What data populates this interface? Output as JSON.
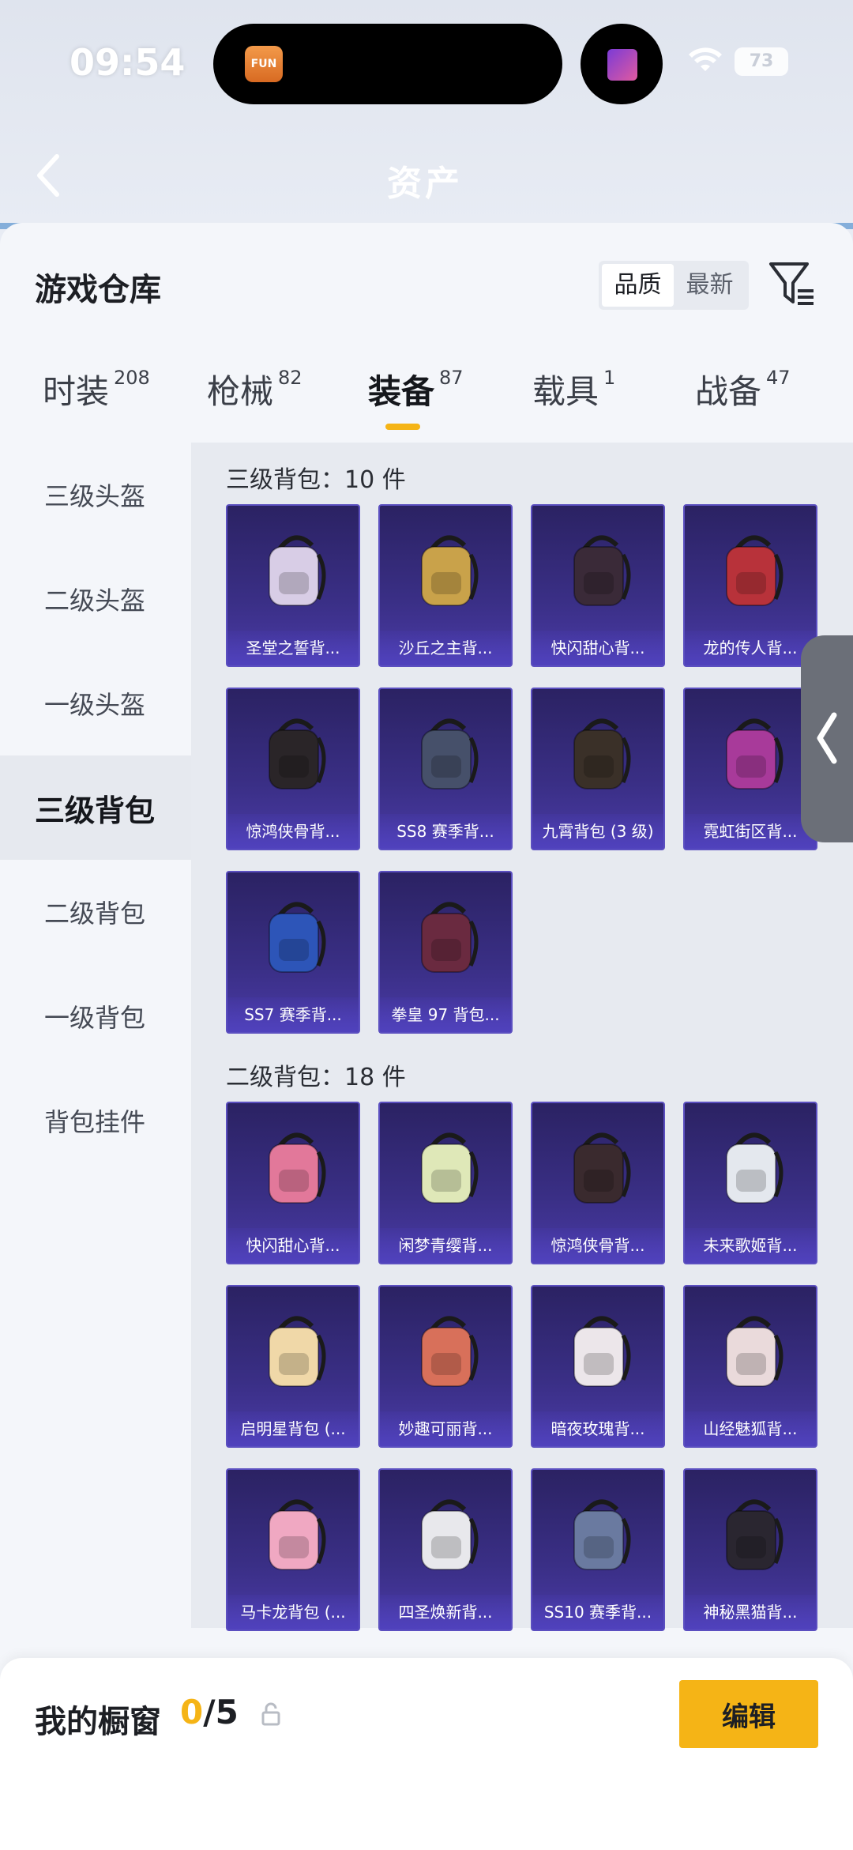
{
  "status_bar": {
    "time": "09:54",
    "battery": "73",
    "island_app_label": "FUN"
  },
  "header": {
    "title": "资产"
  },
  "sheet": {
    "title": "游戏仓库",
    "sort_options": [
      "品质",
      "最新"
    ],
    "sort_active": "品质"
  },
  "tabs": [
    {
      "label": "时装",
      "count": "208"
    },
    {
      "label": "枪械",
      "count": "82"
    },
    {
      "label": "装备",
      "count": "87"
    },
    {
      "label": "载具",
      "count": "1"
    },
    {
      "label": "战备",
      "count": "47"
    }
  ],
  "active_tab": "装备",
  "sidenav": [
    "三级头盔",
    "二级头盔",
    "一级头盔",
    "三级背包",
    "二级背包",
    "一级背包",
    "背包挂件"
  ],
  "sidenav_active": "三级背包",
  "sections": [
    {
      "title": "三级背包：10 件",
      "items": [
        {
          "name": "圣堂之誓背...",
          "art": "winged-backpack-icon",
          "color": "#d8cde6"
        },
        {
          "name": "沙丘之主背...",
          "art": "scroll-backpack-icon",
          "color": "#c9a24a"
        },
        {
          "name": "快闪甜心背...",
          "art": "heart-backpack-icon",
          "color": "#3a2a38"
        },
        {
          "name": "龙的传人背...",
          "art": "dragon-backpack-icon",
          "color": "#b8323a"
        },
        {
          "name": "惊鸿侠骨背...",
          "art": "dark-backpack-icon",
          "color": "#2a2528"
        },
        {
          "name": "SS8 赛季背...",
          "art": "striped-backpack-icon",
          "color": "#46506a"
        },
        {
          "name": "九霄背包 (3 级)",
          "art": "gold-backpack-icon",
          "color": "#3a3028"
        },
        {
          "name": "霓虹街区背...",
          "art": "neon-backpack-icon",
          "color": "#a83a9a"
        },
        {
          "name": "SS7 赛季背...",
          "art": "blue-backpack-icon",
          "color": "#2d55b8"
        },
        {
          "name": "拳皇 97 背包...",
          "art": "kof-backpack-icon",
          "color": "#6a2a40"
        }
      ]
    },
    {
      "title": "二级背包：18 件",
      "items": [
        {
          "name": "快闪甜心背...",
          "art": "pink-round-backpack-icon",
          "color": "#e2789a"
        },
        {
          "name": "闲梦青缨背...",
          "art": "green-pouch-backpack-icon",
          "color": "#dfe8b8"
        },
        {
          "name": "惊鸿侠骨背...",
          "art": "dark-red-backpack-icon",
          "color": "#3a2a2e"
        },
        {
          "name": "未来歌姬背...",
          "art": "white-backpack-icon",
          "color": "#e4e8ee"
        },
        {
          "name": "启明星背包 (...",
          "art": "cream-backpack-icon",
          "color": "#f0d8a8"
        },
        {
          "name": "妙趣可丽背...",
          "art": "gift-backpack-icon",
          "color": "#d8705a"
        },
        {
          "name": "暗夜玫瑰背...",
          "art": "bunny-backpack-icon",
          "color": "#ece6ea"
        },
        {
          "name": "山经魅狐背...",
          "art": "fox-backpack-icon",
          "color": "#eadadb"
        },
        {
          "name": "马卡龙背包 (...",
          "art": "macaron-backpack-icon",
          "color": "#f0a8c2"
        },
        {
          "name": "四圣焕新背...",
          "art": "capsule-backpack-icon",
          "color": "#e8e8ec"
        },
        {
          "name": "SS10 赛季背...",
          "art": "denim-backpack-icon",
          "color": "#6a7aa0"
        },
        {
          "name": "神秘黑猫背...",
          "art": "cat-backpack-icon",
          "color": "#2a2630"
        }
      ]
    }
  ],
  "showcase": {
    "title": "我的橱窗",
    "current": "0",
    "total": "/5"
  },
  "edit_button": "编辑",
  "colors": {
    "accent": "#f5b416",
    "card_bg": "#3a2f86",
    "sheet_bg": "#f4f6fa"
  }
}
